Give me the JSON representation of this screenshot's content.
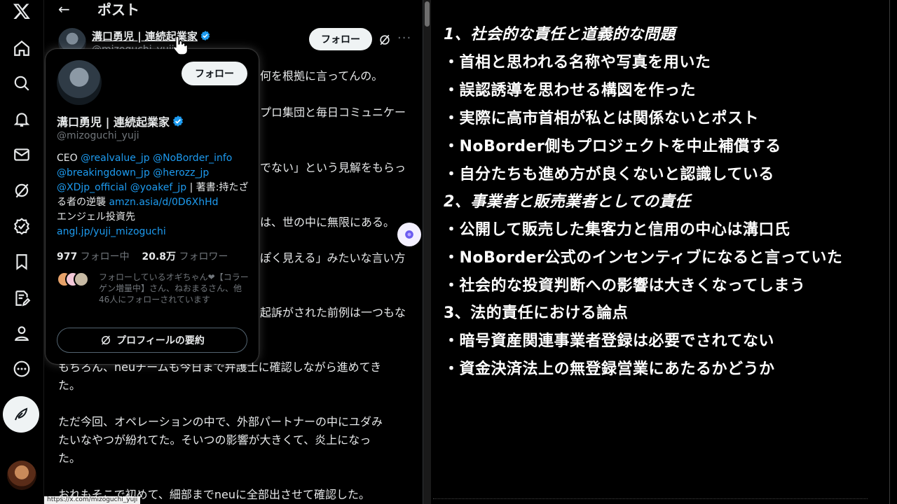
{
  "nav": {
    "items": [
      "x-logo",
      "home",
      "explore",
      "notifications",
      "messages",
      "grok",
      "verified-orgs",
      "bookmarks",
      "premium",
      "profile",
      "more"
    ]
  },
  "column": {
    "title": "ポスト",
    "author": {
      "name": "溝口勇児 | 連続起業家",
      "handle": "@mizoguchi_yuji",
      "follow_label": "フォロー"
    },
    "post_lines": [
      "何を根拠に言ってんの。",
      "プロ集団と毎日コミュニケー",
      "でない」という見解をもらっ",
      "は、世の中に無限にある。",
      "ぽく見える」みたいな言い方",
      "起訴がされた前例は一つもな",
      "もちろん、neuチームも今日まで弁護士に確認しながら進めてき",
      "た。",
      "ただ今回、オペレーションの中で、外部パートナーの中にユダみ",
      "たいなやつが紛れてた。そいつの影響が大きくて、炎上になっ",
      "た。",
      "おれもそこで初めて、細部までneuに全部出させて確認した。"
    ]
  },
  "hovercard": {
    "follow_label": "フォロー",
    "name": "溝口勇児 | 連続起業家",
    "handle": "@mizoguchi_yuji",
    "bio": {
      "ceo_prefix": "CEO ",
      "link1": "@realvalue_jp",
      "link2": "@NoBorder_info",
      "link3": "@breakingdown_jp",
      "link4": "@herozz_jp",
      "link5": "@XDjp_official",
      "link6": "@yoakef_jp",
      "book_text": " | 著書:持たざる者の逆襲 ",
      "link7": "amzn.asia/d/0D6XhHd",
      "angel": "エンジェル投資先",
      "link8": "angl.jp/yuji_mizoguchi"
    },
    "following_count": "977",
    "following_label": " フォロー中",
    "followers_count": "20.8万",
    "followers_label": " フォロワー",
    "followed_by": "フォローしているオギちゃん❤【コラーゲン増量中】さん、ねおまるさん、他46人にフォローされています",
    "summary_label": "プロフィールの要約"
  },
  "status_url": "https://x.com/mizoguchi_yuji",
  "memo": {
    "lines": [
      {
        "text": "1、社会的な責任と道義的な問題",
        "heading": true
      },
      {
        "text": "・首相と思われる名称や写真を用いた",
        "heading": false
      },
      {
        "text": "・誤認誘導を思わせる構図を作った",
        "heading": false
      },
      {
        "text": "・実際に高市首相が私とは関係ないとポスト",
        "heading": false
      },
      {
        "text": "・NoBorder側もプロジェクトを中止補償する",
        "heading": false
      },
      {
        "text": "・自分たちも進め方が良くないと認識している",
        "heading": false
      },
      {
        "text": "2、事業者と販売業者としての責任",
        "heading": true
      },
      {
        "text": "・公開して販売した集客力と信用の中心は溝口氏",
        "heading": false
      },
      {
        "text": "・NoBorder公式のインセンティブになると言っていた",
        "heading": false
      },
      {
        "text": "・社会的な投資判断への影響は大きくなってしまう",
        "heading": false
      },
      {
        "text": "3、法的責任における論点",
        "heading": false
      },
      {
        "text": "・暗号資産関連事業者登録は必要でされてない",
        "heading": false
      },
      {
        "text": "・資金決済法上の無登録営業にあたるかどうか",
        "heading": false
      }
    ]
  },
  "colors": {
    "accent": "#1d9bf0",
    "background": "#000000",
    "text": "#e7e9ea",
    "muted": "#71767b",
    "memo_text": "#ffffff"
  }
}
